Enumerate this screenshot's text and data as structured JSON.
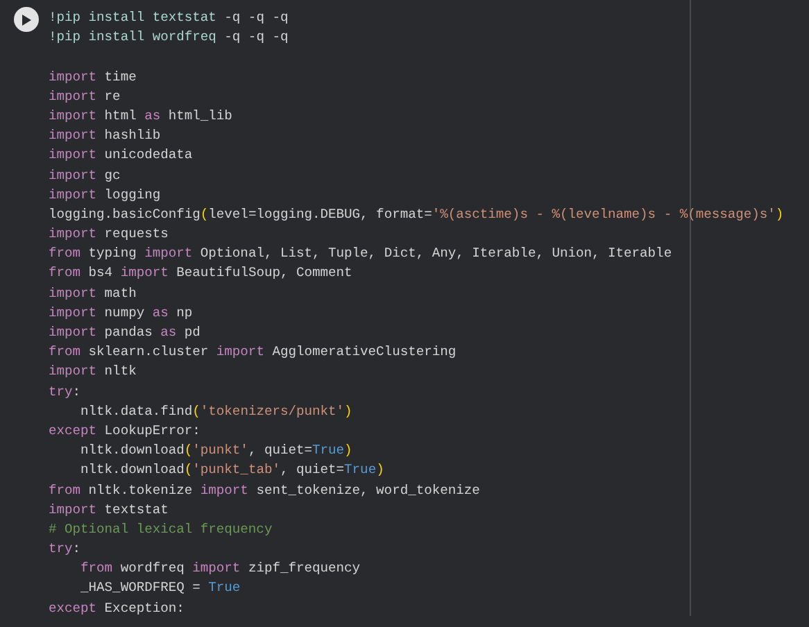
{
  "cell": {
    "run_button": {
      "kind": "play"
    },
    "lines": [
      {
        "kind": "code",
        "tokens": [
          {
            "kind": "shell",
            "text": "!pip install textstat"
          },
          {
            "kind": "plain",
            "text": " -q -q -q"
          }
        ]
      },
      {
        "kind": "code",
        "tokens": [
          {
            "kind": "shell",
            "text": "!pip install wordfreq"
          },
          {
            "kind": "plain",
            "text": " -q -q -q"
          }
        ]
      },
      {
        "kind": "blank"
      },
      {
        "kind": "code",
        "tokens": [
          {
            "kind": "keyword",
            "text": "import"
          },
          {
            "kind": "plain",
            "text": " time"
          }
        ]
      },
      {
        "kind": "code",
        "tokens": [
          {
            "kind": "keyword",
            "text": "import"
          },
          {
            "kind": "plain",
            "text": " re"
          }
        ]
      },
      {
        "kind": "code",
        "tokens": [
          {
            "kind": "keyword",
            "text": "import"
          },
          {
            "kind": "plain",
            "text": " html "
          },
          {
            "kind": "keyword",
            "text": "as"
          },
          {
            "kind": "plain",
            "text": " html_lib"
          }
        ]
      },
      {
        "kind": "code",
        "tokens": [
          {
            "kind": "keyword",
            "text": "import"
          },
          {
            "kind": "plain",
            "text": " hashlib"
          }
        ]
      },
      {
        "kind": "code",
        "tokens": [
          {
            "kind": "keyword",
            "text": "import"
          },
          {
            "kind": "plain",
            "text": " unicodedata"
          }
        ]
      },
      {
        "kind": "code",
        "tokens": [
          {
            "kind": "keyword",
            "text": "import"
          },
          {
            "kind": "plain",
            "text": " gc"
          }
        ]
      },
      {
        "kind": "code",
        "tokens": [
          {
            "kind": "keyword",
            "text": "import"
          },
          {
            "kind": "plain",
            "text": " logging"
          }
        ]
      },
      {
        "kind": "code",
        "tokens": [
          {
            "kind": "plain",
            "text": "logging.basicConfig"
          },
          {
            "kind": "paren",
            "text": "("
          },
          {
            "kind": "plain",
            "text": "level=logging.DEBUG, format="
          },
          {
            "kind": "string",
            "text": "'%(asctime)s - %(levelname)s - %(message)s'"
          },
          {
            "kind": "paren",
            "text": ")"
          }
        ]
      },
      {
        "kind": "code",
        "tokens": [
          {
            "kind": "keyword",
            "text": "import"
          },
          {
            "kind": "plain",
            "text": " requests"
          }
        ]
      },
      {
        "kind": "code",
        "tokens": [
          {
            "kind": "keyword",
            "text": "from"
          },
          {
            "kind": "plain",
            "text": " typing "
          },
          {
            "kind": "keyword",
            "text": "import"
          },
          {
            "kind": "plain",
            "text": " Optional, List, Tuple, Dict, Any, Iterable, Union, Iterable"
          }
        ]
      },
      {
        "kind": "code",
        "tokens": [
          {
            "kind": "keyword",
            "text": "from"
          },
          {
            "kind": "plain",
            "text": " bs4 "
          },
          {
            "kind": "keyword",
            "text": "import"
          },
          {
            "kind": "plain",
            "text": " BeautifulSoup, Comment"
          }
        ]
      },
      {
        "kind": "code",
        "tokens": [
          {
            "kind": "keyword",
            "text": "import"
          },
          {
            "kind": "plain",
            "text": " math"
          }
        ]
      },
      {
        "kind": "code",
        "tokens": [
          {
            "kind": "keyword",
            "text": "import"
          },
          {
            "kind": "plain",
            "text": " numpy "
          },
          {
            "kind": "keyword",
            "text": "as"
          },
          {
            "kind": "plain",
            "text": " np"
          }
        ]
      },
      {
        "kind": "code",
        "tokens": [
          {
            "kind": "keyword",
            "text": "import"
          },
          {
            "kind": "plain",
            "text": " pandas "
          },
          {
            "kind": "keyword",
            "text": "as"
          },
          {
            "kind": "plain",
            "text": " pd"
          }
        ]
      },
      {
        "kind": "code",
        "tokens": [
          {
            "kind": "keyword",
            "text": "from"
          },
          {
            "kind": "plain",
            "text": " sklearn.cluster "
          },
          {
            "kind": "keyword",
            "text": "import"
          },
          {
            "kind": "plain",
            "text": " AgglomerativeClustering"
          }
        ]
      },
      {
        "kind": "code",
        "tokens": [
          {
            "kind": "keyword",
            "text": "import"
          },
          {
            "kind": "plain",
            "text": " nltk"
          }
        ]
      },
      {
        "kind": "code",
        "tokens": [
          {
            "kind": "keyword",
            "text": "try"
          },
          {
            "kind": "plain",
            "text": ":"
          }
        ]
      },
      {
        "kind": "code",
        "tokens": [
          {
            "kind": "plain",
            "text": "    nltk.data.find"
          },
          {
            "kind": "paren",
            "text": "("
          },
          {
            "kind": "string",
            "text": "'tokenizers/punkt'"
          },
          {
            "kind": "paren",
            "text": ")"
          }
        ]
      },
      {
        "kind": "code",
        "tokens": [
          {
            "kind": "keyword",
            "text": "except"
          },
          {
            "kind": "plain",
            "text": " LookupError:"
          }
        ]
      },
      {
        "kind": "code",
        "tokens": [
          {
            "kind": "plain",
            "text": "    nltk.download"
          },
          {
            "kind": "paren",
            "text": "("
          },
          {
            "kind": "string",
            "text": "'punkt'"
          },
          {
            "kind": "plain",
            "text": ", quiet="
          },
          {
            "kind": "constant",
            "text": "True"
          },
          {
            "kind": "paren",
            "text": ")"
          }
        ]
      },
      {
        "kind": "code",
        "tokens": [
          {
            "kind": "plain",
            "text": "    nltk.download"
          },
          {
            "kind": "paren",
            "text": "("
          },
          {
            "kind": "string",
            "text": "'punkt_tab'"
          },
          {
            "kind": "plain",
            "text": ", quiet="
          },
          {
            "kind": "constant",
            "text": "True"
          },
          {
            "kind": "paren",
            "text": ")"
          }
        ]
      },
      {
        "kind": "code",
        "tokens": [
          {
            "kind": "keyword",
            "text": "from"
          },
          {
            "kind": "plain",
            "text": " nltk.tokenize "
          },
          {
            "kind": "keyword",
            "text": "import"
          },
          {
            "kind": "plain",
            "text": " sent_tokenize, word_tokenize"
          }
        ]
      },
      {
        "kind": "code",
        "tokens": [
          {
            "kind": "keyword",
            "text": "import"
          },
          {
            "kind": "plain",
            "text": " textstat"
          }
        ]
      },
      {
        "kind": "code",
        "tokens": [
          {
            "kind": "comment",
            "text": "# Optional lexical frequency"
          }
        ]
      },
      {
        "kind": "code",
        "tokens": [
          {
            "kind": "keyword",
            "text": "try"
          },
          {
            "kind": "plain",
            "text": ":"
          }
        ]
      },
      {
        "kind": "code",
        "tokens": [
          {
            "kind": "keyword",
            "text": "    from"
          },
          {
            "kind": "plain",
            "text": " wordfreq "
          },
          {
            "kind": "keyword",
            "text": "import"
          },
          {
            "kind": "plain",
            "text": " zipf_frequency"
          }
        ]
      },
      {
        "kind": "code",
        "tokens": [
          {
            "kind": "plain",
            "text": "    _HAS_WORDFREQ = "
          },
          {
            "kind": "constant",
            "text": "True"
          }
        ]
      },
      {
        "kind": "code",
        "tokens": [
          {
            "kind": "keyword",
            "text": "except"
          },
          {
            "kind": "plain",
            "text": " Exception:"
          }
        ]
      }
    ]
  }
}
